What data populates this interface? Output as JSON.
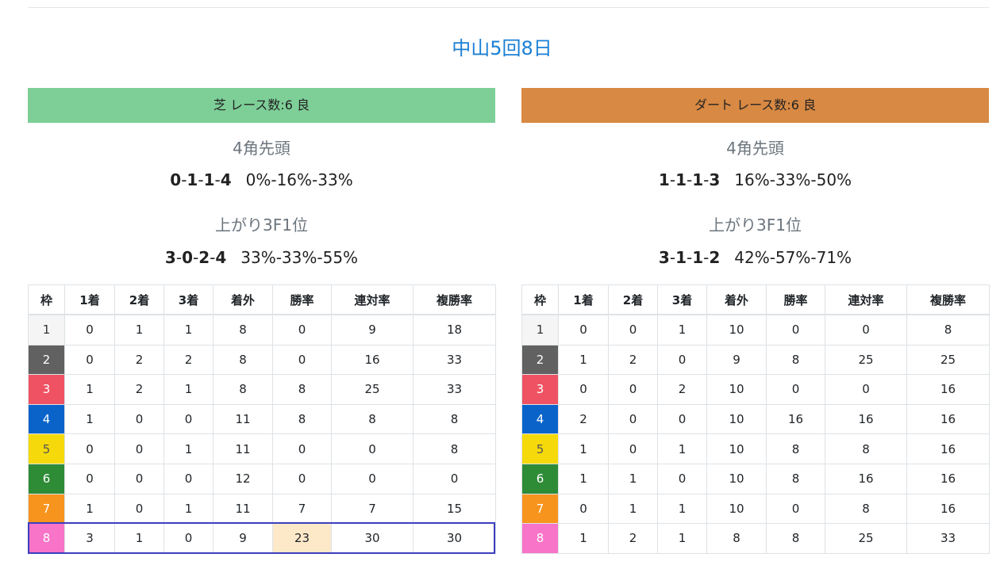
{
  "page_title": "中山5回8日",
  "colors": {
    "title": "#1a7fd4",
    "turf_header": "#7dcf97",
    "dirt_header": "#d88943",
    "highlight_border": "#3b3fbf",
    "highlight_cell": "#fde8c8",
    "waku": [
      "#f5f5f5",
      "#616161",
      "#ef5363",
      "#0a63c9",
      "#f5d90a",
      "#2e8b36",
      "#f7941d",
      "#f774c8"
    ]
  },
  "columns": [
    "枠",
    "1着",
    "2着",
    "3着",
    "着外",
    "勝率",
    "連対率",
    "複勝率"
  ],
  "turf": {
    "header": "芝 レース数:6  良",
    "leader_label": "4角先頭",
    "leader_record": [
      "0",
      "1",
      "1",
      "4"
    ],
    "leader_rates": "0%-16%-33%",
    "last3f_label": "上がり3F1位",
    "last3f_record": [
      "3",
      "0",
      "2",
      "4"
    ],
    "last3f_rates": "33%-33%-55%",
    "rows": [
      [
        "1",
        "0",
        "1",
        "1",
        "8",
        "0",
        "9",
        "18"
      ],
      [
        "2",
        "0",
        "2",
        "2",
        "8",
        "0",
        "16",
        "33"
      ],
      [
        "3",
        "1",
        "2",
        "1",
        "8",
        "8",
        "25",
        "33"
      ],
      [
        "4",
        "1",
        "0",
        "0",
        "11",
        "8",
        "8",
        "8"
      ],
      [
        "5",
        "0",
        "0",
        "1",
        "11",
        "0",
        "0",
        "8"
      ],
      [
        "6",
        "0",
        "0",
        "0",
        "12",
        "0",
        "0",
        "0"
      ],
      [
        "7",
        "1",
        "0",
        "1",
        "11",
        "7",
        "7",
        "15"
      ],
      [
        "8",
        "3",
        "1",
        "0",
        "9",
        "23",
        "30",
        "30"
      ]
    ]
  },
  "dirt": {
    "header": "ダート レース数:6  良",
    "leader_label": "4角先頭",
    "leader_record": [
      "1",
      "1",
      "1",
      "3"
    ],
    "leader_rates": "16%-33%-50%",
    "last3f_label": "上がり3F1位",
    "last3f_record": [
      "3",
      "1",
      "1",
      "2"
    ],
    "last3f_rates": "42%-57%-71%",
    "rows": [
      [
        "1",
        "0",
        "0",
        "1",
        "10",
        "0",
        "0",
        "8"
      ],
      [
        "2",
        "1",
        "2",
        "0",
        "9",
        "8",
        "25",
        "25"
      ],
      [
        "3",
        "0",
        "0",
        "2",
        "10",
        "0",
        "0",
        "16"
      ],
      [
        "4",
        "2",
        "0",
        "0",
        "10",
        "16",
        "16",
        "16"
      ],
      [
        "5",
        "1",
        "0",
        "1",
        "10",
        "8",
        "8",
        "16"
      ],
      [
        "6",
        "1",
        "1",
        "0",
        "10",
        "8",
        "16",
        "16"
      ],
      [
        "7",
        "0",
        "1",
        "1",
        "10",
        "0",
        "8",
        "16"
      ],
      [
        "8",
        "1",
        "2",
        "1",
        "8",
        "8",
        "25",
        "33"
      ]
    ]
  }
}
